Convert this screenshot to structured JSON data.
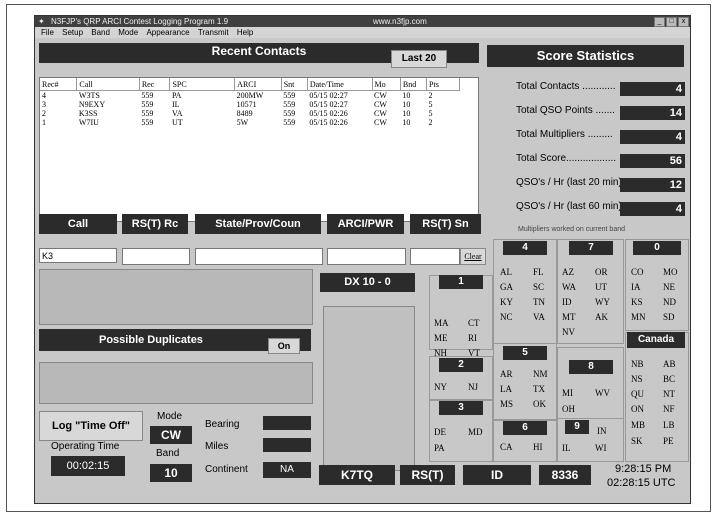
{
  "window": {
    "title": "N3FJP's QRP ARCI Contest Logging Program 1.9",
    "url": "www.n3fjp.com",
    "controls": [
      "_",
      "□",
      "x"
    ]
  },
  "menu": [
    "File",
    "Setup",
    "Band",
    "Mode",
    "Appearance",
    "Transmit",
    "Help"
  ],
  "recent": {
    "title": "Recent Contacts",
    "last_button": "Last 20",
    "columns": [
      "Rec#",
      "Call",
      "Rec",
      "SPC",
      "ARCI",
      "Snt",
      "Date/Time",
      "Mo",
      "Bnd",
      "Pts"
    ],
    "rows": [
      [
        "4",
        "W3TS",
        "559",
        "PA",
        "200MW",
        "559",
        "05/15 02:27",
        "CW",
        "10",
        "2"
      ],
      [
        "3",
        "N9EXY",
        "559",
        "IL",
        "10571",
        "559",
        "05/15 02:27",
        "CW",
        "10",
        "5"
      ],
      [
        "2",
        "K3SS",
        "559",
        "VA",
        "8489",
        "559",
        "05/15 02:26",
        "CW",
        "10",
        "5"
      ],
      [
        "1",
        "W7IU",
        "559",
        "UT",
        "5W",
        "559",
        "05/15 02:26",
        "CW",
        "10",
        "2"
      ]
    ]
  },
  "score": {
    "title": "Score Statistics",
    "items": [
      {
        "label": "Total Contacts ............",
        "value": "4"
      },
      {
        "label": "Total QSO Points .......",
        "value": "14"
      },
      {
        "label": "Total Multipliers .........",
        "value": "4"
      },
      {
        "label": "Total Score..................",
        "value": "56"
      },
      {
        "label": "QSO's / Hr (last 20 min)",
        "value": "12"
      },
      {
        "label": "QSO's / Hr (last 60 min)",
        "value": "4"
      }
    ]
  },
  "entry": {
    "labels": [
      "Call",
      "RS(T) Rc",
      "State/Prov/Coun",
      "ARCI/PWR",
      "RS(T) Sn"
    ],
    "call_value": "K3",
    "clear": "Clear"
  },
  "multipliers": {
    "title": "Multipliers worked on current band",
    "groups": {
      "g1": {
        "num": "1",
        "states": [
          "MA",
          "CT",
          "ME",
          "RI",
          "NH",
          "VT"
        ]
      },
      "g2": {
        "num": "2",
        "states": [
          "NY",
          "NJ"
        ]
      },
      "g3": {
        "num": "3",
        "states": [
          "DE",
          "MD",
          "PA"
        ]
      },
      "g4": {
        "num": "4",
        "states": [
          "AL",
          "FL",
          "GA",
          "SC",
          "KY",
          "TN",
          "NC",
          "VA"
        ]
      },
      "g5": {
        "num": "5",
        "states": [
          "AR",
          "NM",
          "LA",
          "TX",
          "MS",
          "OK"
        ]
      },
      "g6": {
        "num": "6",
        "states": [
          "CA",
          "HI"
        ]
      },
      "g7": {
        "num": "7",
        "states": [
          "AZ",
          "OR",
          "WA",
          "UT",
          "ID",
          "WY",
          "MT",
          "AK",
          "NV"
        ]
      },
      "g8": {
        "num": "8",
        "states": [
          "MI",
          "WV",
          "OH"
        ]
      },
      "g9": {
        "num": "9",
        "states": [
          "IN",
          "IL",
          "WI"
        ]
      },
      "g0": {
        "num": "0",
        "states": [
          "CO",
          "MO",
          "IA",
          "NE",
          "KS",
          "ND",
          "MN",
          "SD"
        ]
      },
      "canada": {
        "num": "Canada",
        "states": [
          "NB",
          "AB",
          "NS",
          "BC",
          "QU",
          "NT",
          "ON",
          "NF",
          "MB",
          "LB",
          "SK",
          "PE"
        ]
      }
    }
  },
  "dx": {
    "title": "DX 10 - 0"
  },
  "duplicates": {
    "title": "Possible Duplicates",
    "toggle": "On"
  },
  "bottom": {
    "log_time_off": "Log \"Time Off\"",
    "operating_time_label": "Operating Time",
    "operating_time": "00:02:15",
    "mode_label": "Mode",
    "mode": "CW",
    "band_label": "Band",
    "band": "10",
    "bearing_label": "Bearing",
    "miles_label": "Miles",
    "continent_label": "Continent",
    "continent": "NA",
    "my_call": "K7TQ",
    "rst": "RS(T)",
    "id": "ID",
    "id_value": "8336",
    "local_time": "9:28:15  PM",
    "utc_time": "02:28:15  UTC"
  }
}
